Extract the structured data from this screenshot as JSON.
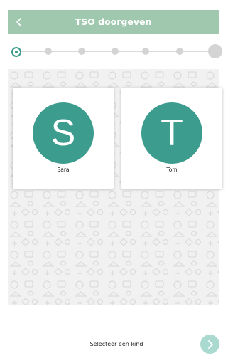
{
  "header": {
    "title": "TSO doorgeven",
    "back_icon": "chevron-left-icon",
    "background_color": "#9fc8ae"
  },
  "stepper": {
    "total_steps": 7,
    "current_step": 1
  },
  "children": [
    {
      "initial": "S",
      "name": "Sara"
    },
    {
      "initial": "T",
      "name": "Tom"
    }
  ],
  "footer": {
    "instruction": "Selecteer een kind",
    "next_icon": "chevron-right-icon"
  },
  "colors": {
    "accent": "#3c9c8e",
    "next_button": "#a9d9cf",
    "pattern_background": "#f1f1f1"
  }
}
